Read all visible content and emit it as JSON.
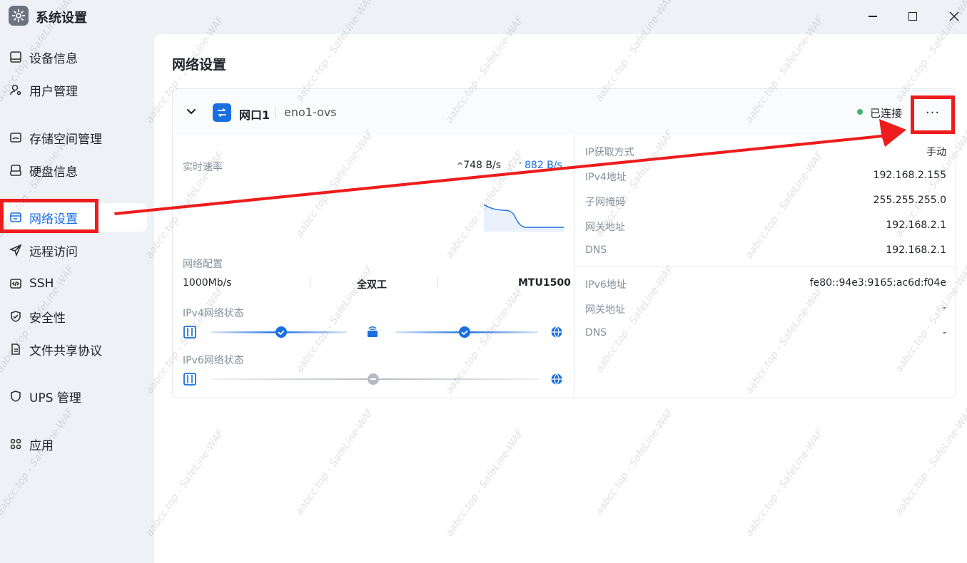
{
  "window": {
    "title": "系统设置",
    "icon": "gear-icon"
  },
  "sidebar": {
    "items": [
      {
        "label": "设备信息",
        "icon": "device-icon"
      },
      {
        "label": "用户管理",
        "icon": "user-gear-icon"
      },
      {
        "label": "存储空间管理",
        "icon": "storage-icon"
      },
      {
        "label": "硬盘信息",
        "icon": "disk-icon"
      },
      {
        "label": "网络设置",
        "icon": "network-icon",
        "active": true
      },
      {
        "label": "远程访问",
        "icon": "send-icon"
      },
      {
        "label": "SSH",
        "icon": "code-icon"
      },
      {
        "label": "安全性",
        "icon": "shield-check-icon"
      },
      {
        "label": "文件共享协议",
        "icon": "file-icon"
      },
      {
        "label": "UPS 管理",
        "icon": "shield-icon"
      },
      {
        "label": "应用",
        "icon": "apps-icon"
      }
    ]
  },
  "main": {
    "title": "网络设置",
    "interface": {
      "name": "网口1",
      "device": "eno1-ovs",
      "status": "已连接",
      "more": "···",
      "realtime": {
        "label": "实时速率",
        "upload": "748 B/s",
        "download": "882 B/s"
      },
      "config": {
        "label": "网络配置",
        "speed": "1000Mb/s",
        "duplex": "全双工",
        "mtu": "MTU1500"
      },
      "ipv4_status": {
        "label": "IPv4网络状态",
        "gateway_ok": true,
        "internet_ok": true
      },
      "ipv6_status": {
        "label": "IPv6网络状态",
        "gateway_ok": false
      },
      "ipv4": [
        {
          "key": "IP获取方式",
          "value": "手动"
        },
        {
          "key": "IPv4地址",
          "value": "192.168.2.155"
        },
        {
          "key": "子网掩码",
          "value": "255.255.255.0"
        },
        {
          "key": "网关地址",
          "value": "192.168.2.1"
        },
        {
          "key": "DNS",
          "value": "192.168.2.1"
        }
      ],
      "ipv6": [
        {
          "key": "IPv6地址",
          "value": "fe80::94e3:9165:ac6d:f04e"
        },
        {
          "key": "网关地址",
          "value": "-"
        },
        {
          "key": "DNS",
          "value": "-"
        }
      ]
    }
  },
  "watermark": "aabcc.top - SafeLine-WAF",
  "colors": {
    "accent": "#1a6fe0",
    "connected": "#3fb56b",
    "annotation": "#ee1c1c"
  }
}
